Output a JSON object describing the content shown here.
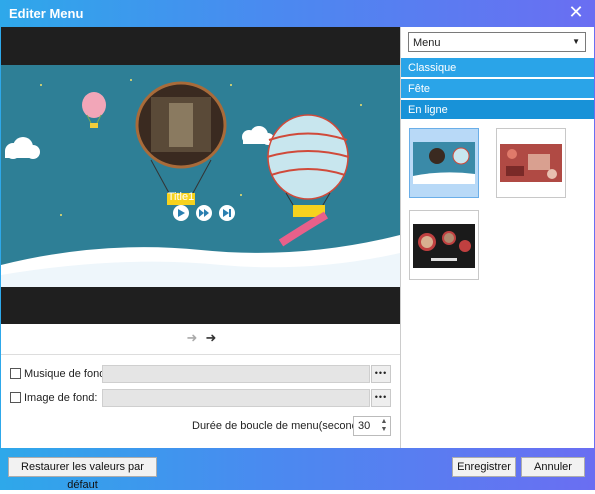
{
  "window": {
    "title": "Editer Menu"
  },
  "preview": {
    "menu_title": "Title1"
  },
  "settings": {
    "music_label": "Musique de fond:",
    "image_label": "Image de fond:",
    "browse_label": "•••",
    "loop_label": "Durée de boucle de menu(secondes):",
    "loop_value": "30"
  },
  "panel": {
    "dropdown_value": "Menu",
    "categories": [
      {
        "label": "Classique"
      },
      {
        "label": "Fête"
      },
      {
        "label": "En ligne"
      }
    ],
    "selected_category": "En ligne"
  },
  "footer": {
    "reset_label": "Restaurer les valeurs par défaut",
    "save_label": "Enregistrer",
    "cancel_label": "Annuler"
  },
  "colors": {
    "accent": "#2aa4e8",
    "scene_bg": "#2e7f96"
  }
}
